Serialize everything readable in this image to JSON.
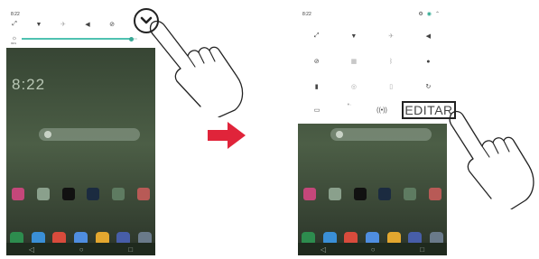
{
  "left_phone": {
    "status_time": "8:22",
    "brightness_percent": "99%",
    "brightness_level": 0.95,
    "clock": "8:22"
  },
  "right_phone": {
    "status_time": "8:22",
    "edit_button": "EDITAR"
  },
  "colors": {
    "arrow": "#e0243a",
    "slider": "#4fc1b0",
    "shade": "#ffffff"
  },
  "icons": [
    "rotate-icon",
    "wifi-icon",
    "airplane-icon",
    "volume-icon",
    "dnd-icon",
    "chevron-down-icon",
    "brightness-icon",
    "location-icon",
    "sync-icon",
    "cast-icon",
    "hotspot-icon",
    "settings-icon",
    "account-icon"
  ]
}
